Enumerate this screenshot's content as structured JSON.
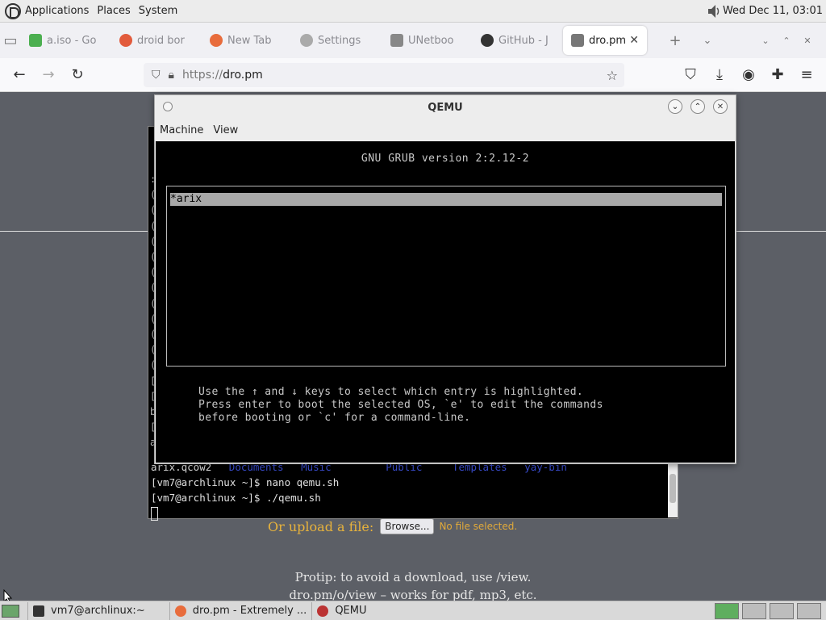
{
  "top_panel": {
    "menus": [
      "Applications",
      "Places",
      "System"
    ],
    "clock": "Wed Dec 11, 03:01"
  },
  "browser": {
    "tabs": [
      {
        "label": "a.iso - Go",
        "color": "#4caf50"
      },
      {
        "label": "droid bor",
        "color": "#e25b3c"
      },
      {
        "label": "New Tab",
        "color": "#e86c3c"
      },
      {
        "label": "Settings",
        "color": "#999999"
      },
      {
        "label": "UNetboo",
        "color": "#777777"
      },
      {
        "label": "GitHub - J",
        "color": "#333333"
      },
      {
        "label": "dro.pm",
        "color": "#777777",
        "active": true
      }
    ],
    "url_proto": "https://",
    "url_host": "dro.pm"
  },
  "page": {
    "upload_label": "Or upload a file:",
    "browse_button": "Browse...",
    "no_file": "No file selected.",
    "protip_line1": "Protip: to avoid a download, use /view.",
    "protip_line2": "dro.pm/o/view – works for pdf, mp3, etc."
  },
  "terminal": {
    "ls_items": [
      "arix.qcow2",
      "Documents",
      "Music",
      "Public",
      "Templates",
      "yay-bin"
    ],
    "prompt1": "[vm7@archlinux ~]$ nano qemu.sh",
    "prompt2": "[vm7@archlinux ~]$ ./qemu.sh"
  },
  "qemu": {
    "title": "QEMU",
    "menu": [
      "Machine",
      "View"
    ],
    "grub_header": "GNU GRUB  version 2:2.12-2",
    "grub_entry": "*arix",
    "grub_help": "Use the ↑ and ↓ keys to select which entry is highlighted.\nPress enter to boot the selected OS, `e' to edit the commands\nbefore booting or `c' for a command-line."
  },
  "taskbar": {
    "items": [
      "vm7@archlinux:~",
      "dro.pm - Extremely ...",
      "QEMU"
    ]
  }
}
